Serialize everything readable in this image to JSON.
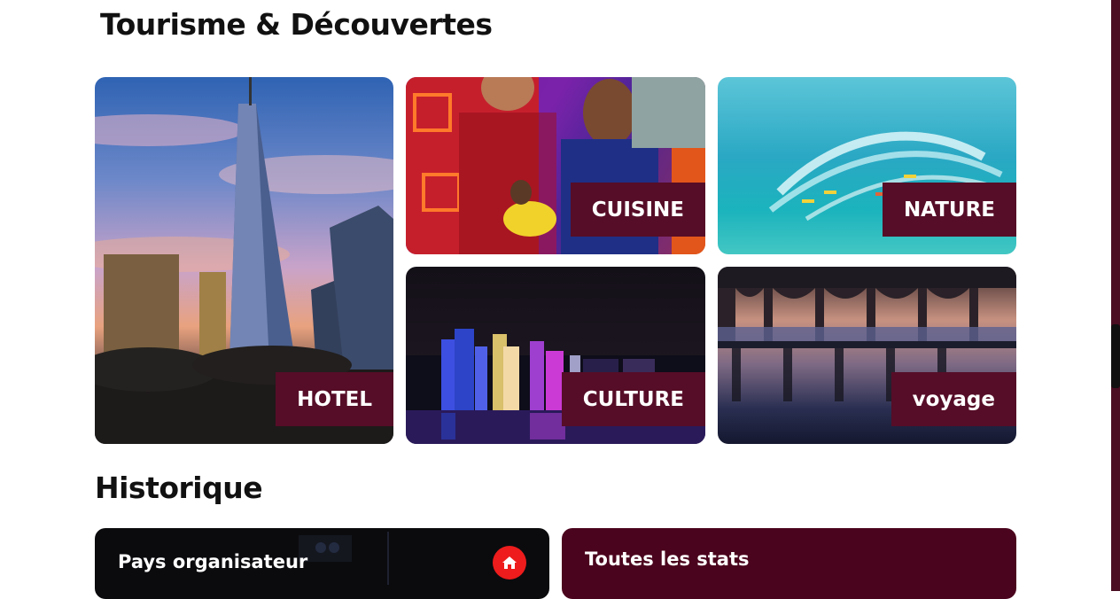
{
  "sections": {
    "tourism_title": "Tourisme & Découvertes",
    "history_title": "Historique"
  },
  "tiles": {
    "hotel": "HOTEL",
    "cuisine": "CUISINE",
    "nature": "NATURE",
    "culture": "CULTURE",
    "voyage": "voyage"
  },
  "cards": {
    "pays": "Pays organisateur",
    "stats": "Toutes les stats",
    "home_icon": "home-icon"
  },
  "colors": {
    "label_bg": "#560d27",
    "stats_bg": "#4b041d",
    "home_button": "#ee1c1c",
    "scrollbar": "#4a0d22"
  }
}
